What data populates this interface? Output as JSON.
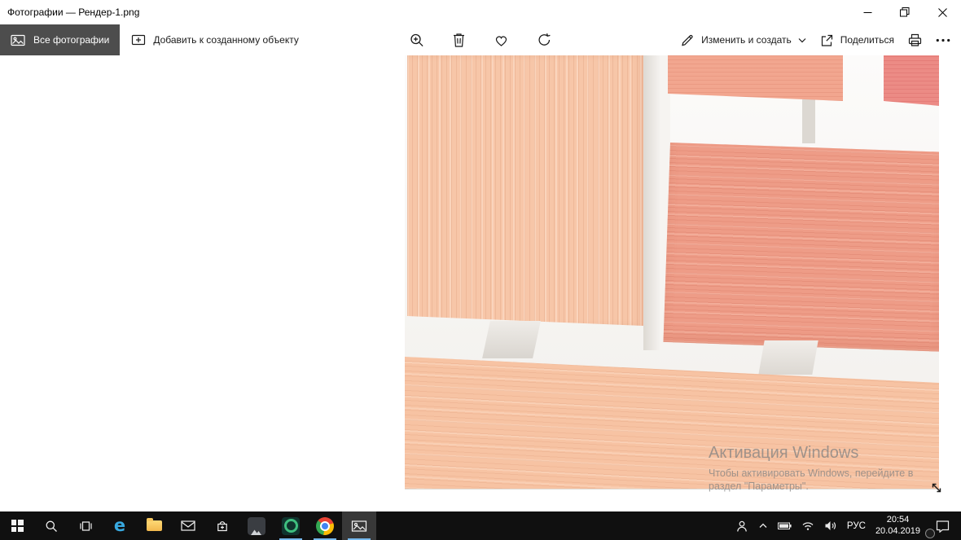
{
  "window": {
    "title": "Фотографии — Рендер-1.png"
  },
  "toolbar": {
    "all_photos_label": "Все фотографии",
    "add_to_label": "Добавить к созданному объекту",
    "edit_create_label": "Изменить и создать",
    "share_label": "Поделиться"
  },
  "photo_viewer": {
    "watermark": {
      "title": "Активация Windows",
      "line1": "Чтобы активировать Windows, перейдите в",
      "line2": "раздел \"Параметры\"."
    }
  },
  "taskbar": {
    "language_label": "РУС",
    "time": "20:54",
    "date": "20.04.2019",
    "edge_glyph": "e"
  },
  "icons": {
    "zoom_in": "magnifier-plus",
    "delete": "trash-can",
    "favorite": "heart-outline",
    "rotate": "circular-arrow",
    "edit_create": "pencil",
    "chevron_down": "˅",
    "share": "box-arrow-out",
    "print": "printer",
    "more": "···",
    "fullscreen": "diagonal-double-arrow"
  },
  "colors": {
    "selected_button_bg": "#4d4d4d",
    "taskbar_bg": "#101010",
    "taskbar_accent_underline": "#76b9ed",
    "panel_light": "#f7c6a8",
    "panel_mid": "#f2a68f",
    "panel_dark": "#ee9c87",
    "panel_red": "#ec8b85",
    "edge_blue": "#38a9e0",
    "folder_yellow": "#f2b84d"
  }
}
